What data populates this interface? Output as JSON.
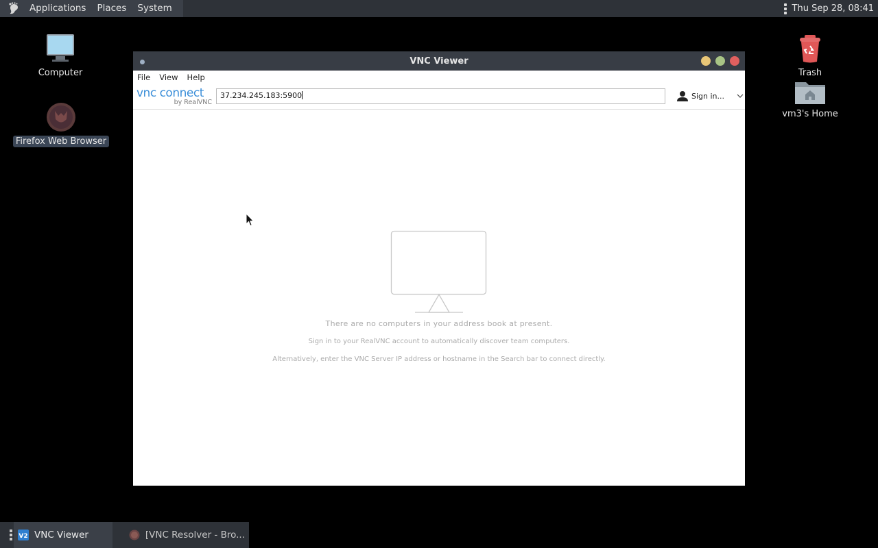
{
  "top_panel": {
    "menus": [
      "Applications",
      "Places",
      "System"
    ],
    "clock": "Thu Sep 28, 08:41"
  },
  "desktop": {
    "icons": [
      {
        "label": "Computer",
        "icon": "computer-icon"
      },
      {
        "label": "Firefox Web Browser",
        "icon": "firefox-icon"
      },
      {
        "label": "Trash",
        "icon": "trash-icon"
      },
      {
        "label": "vm3's Home",
        "icon": "home-folder-icon"
      }
    ]
  },
  "window": {
    "title": "VNC Viewer",
    "menubar": [
      "File",
      "View",
      "Help"
    ],
    "logo": {
      "main": "vnc connect",
      "sub": "by RealVNC"
    },
    "search": {
      "value": "37.234.245.183:5900"
    },
    "signin_label": "Sign in...",
    "empty_messages": [
      "There are no computers in your address book at present.",
      "Sign in to your RealVNC account to automatically discover team computers.",
      "Alternatively, enter the VNC Server IP address or hostname in the Search bar to connect directly."
    ]
  },
  "taskbar": {
    "tasks": [
      {
        "label": "VNC Viewer",
        "icon": "vnc-viewer-icon",
        "active": true
      },
      {
        "label": "[VNC Resolver - Bro...",
        "icon": "firefox-icon",
        "active": false
      }
    ]
  },
  "colors": {
    "panel": "#2e3238",
    "titlebar": "#383d45",
    "accent": "#3c8fd9",
    "close": "#e0605f",
    "minimize": "#e8c677",
    "maximize": "#a8c485"
  }
}
